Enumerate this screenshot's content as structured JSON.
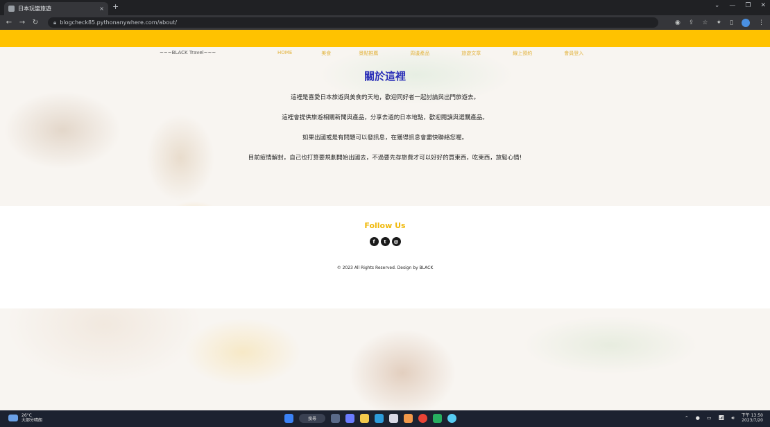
{
  "browser": {
    "tab_title": "日本玩蠻旅遊",
    "tab_close": "×",
    "new_tab": "+",
    "url": "blogcheck85.pythonanywhere.com/about/",
    "window_controls": [
      "⌄",
      "—",
      "❐",
      "✕"
    ]
  },
  "site": {
    "brand": "~~~BLACK Travel~~~",
    "nav": [
      "HOME",
      "美食",
      "景點推薦",
      "周邊產品",
      "旅遊文章",
      "線上預約",
      "會員登入"
    ],
    "about_title": "關於這裡",
    "about_paragraphs": [
      "這裡是喜愛日本旅遊與美食的天地，歡迎同好者一起討論與出門旅遊去。",
      "這裡會提供旅遊相關新聞與產品，分享去過的日本地點，歡迎閱讀與選購產品。",
      "如果出國或是有問題可以發訊息，在獲得訊息會盡快聯絡您喔。",
      "目前疫情解封，自己也打算要規劃開始出國去，不過要先存旅費才可以好好的買東西，吃東西，放鬆心情!"
    ],
    "follow_us": "Follow Us",
    "socials": [
      "f",
      "t",
      "@"
    ],
    "social_icons": [
      "facebook-icon",
      "twitter-icon",
      "instagram-icon"
    ],
    "copyright": "© 2023 All Rights Reserved. Design by BLACK"
  },
  "taskbar": {
    "weather_temp": "26°C",
    "weather_desc": "大部分晴朗",
    "search_label": "搜尋",
    "time": "下午 13:50",
    "date": "2023/7/20"
  },
  "colors": {
    "accent_yellow": "#ffc200",
    "title_blue": "#2a2fb8"
  }
}
